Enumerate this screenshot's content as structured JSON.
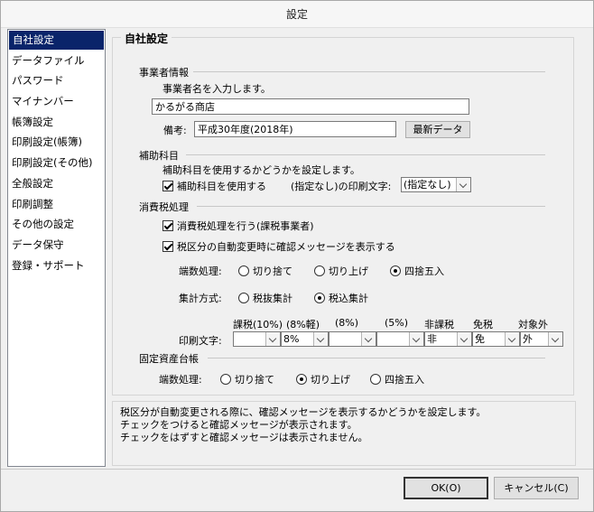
{
  "window": {
    "title": "設定"
  },
  "sidebar": {
    "items": [
      {
        "label": "自社設定",
        "selected": true
      },
      {
        "label": "データファイル"
      },
      {
        "label": "パスワード"
      },
      {
        "label": "マイナンバー"
      },
      {
        "label": "帳簿設定"
      },
      {
        "label": "印刷設定(帳簿)"
      },
      {
        "label": "印刷設定(その他)"
      },
      {
        "label": "全般設定"
      },
      {
        "label": "印刷調整"
      },
      {
        "label": "その他の設定"
      },
      {
        "label": "データ保守"
      },
      {
        "label": "登録・サポート"
      }
    ]
  },
  "main": {
    "title": "自社設定",
    "business": {
      "heading": "事業者情報",
      "instruction": "事業者名を入力します。",
      "name_value": "かるがる商店",
      "note_label": "備考:",
      "note_value": "平成30年度(2018年)",
      "latest_button": "最新データ"
    },
    "subaccount": {
      "heading": "補助科目",
      "instruction": "補助科目を使用するかどうかを設定します。",
      "use_label": "補助科目を使用する",
      "use_checked": true,
      "print_label": "(指定なし)の印刷文字:",
      "print_value": "(指定なし)"
    },
    "tax": {
      "heading": "消費税処理",
      "do_tax_label": "消費税処理を行う(課税事業者)",
      "do_tax_checked": true,
      "confirm_label": "税区分の自動変更時に確認メッセージを表示する",
      "confirm_checked": true,
      "rounding_label": "端数処理:",
      "rounding_options": [
        "切り捨て",
        "切り上げ",
        "四捨五入"
      ],
      "rounding_selected": 2,
      "calc_label": "集計方式:",
      "calc_options": [
        "税抜集計",
        "税込集計"
      ],
      "calc_selected": 1,
      "print_label": "印刷文字:",
      "columns": [
        {
          "header": "課税(10%)",
          "value": ""
        },
        {
          "header": "(8%軽)",
          "value": "8%"
        },
        {
          "header": "(8%)",
          "value": ""
        },
        {
          "header": "(5%)",
          "value": ""
        },
        {
          "header": "非課税",
          "value": "非"
        },
        {
          "header": "免税",
          "value": "免"
        },
        {
          "header": "対象外",
          "value": "外"
        }
      ]
    },
    "fixed_assets": {
      "heading": "固定資産台帳",
      "rounding_label": "端数処理:",
      "rounding_options": [
        "切り捨て",
        "切り上げ",
        "四捨五入"
      ],
      "rounding_selected": 1
    }
  },
  "description": {
    "lines": [
      "税区分が自動変更される際に、確認メッセージを表示するかどうかを設定します。",
      "チェックをつけると確認メッセージが表示されます。",
      "チェックをはずすと確認メッセージは表示されません。"
    ]
  },
  "buttons": {
    "ok": "OK(O)",
    "cancel": "キャンセル(C)"
  }
}
